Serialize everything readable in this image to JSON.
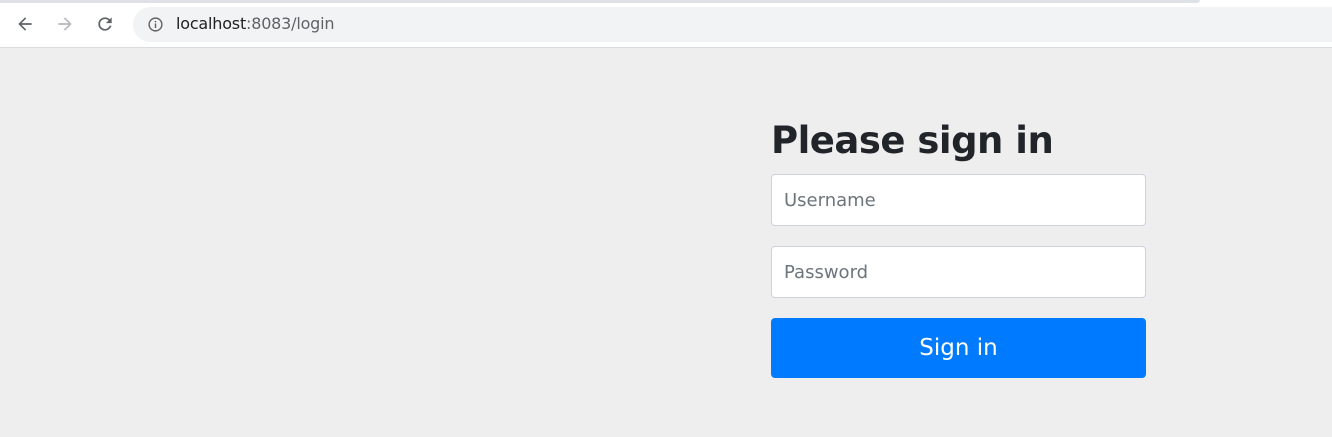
{
  "browser": {
    "url_host": "localhost",
    "url_path": ":8083/login",
    "icons": {
      "back": "arrow-left-icon",
      "forward": "arrow-right-icon",
      "reload": "reload-icon",
      "site_info": "info-icon"
    }
  },
  "login": {
    "heading": "Please sign in",
    "username_placeholder": "Username",
    "password_placeholder": "Password",
    "submit_label": "Sign in"
  },
  "colors": {
    "page_background": "#eeeeee",
    "button_primary": "#007bff",
    "heading_text": "#212529"
  }
}
